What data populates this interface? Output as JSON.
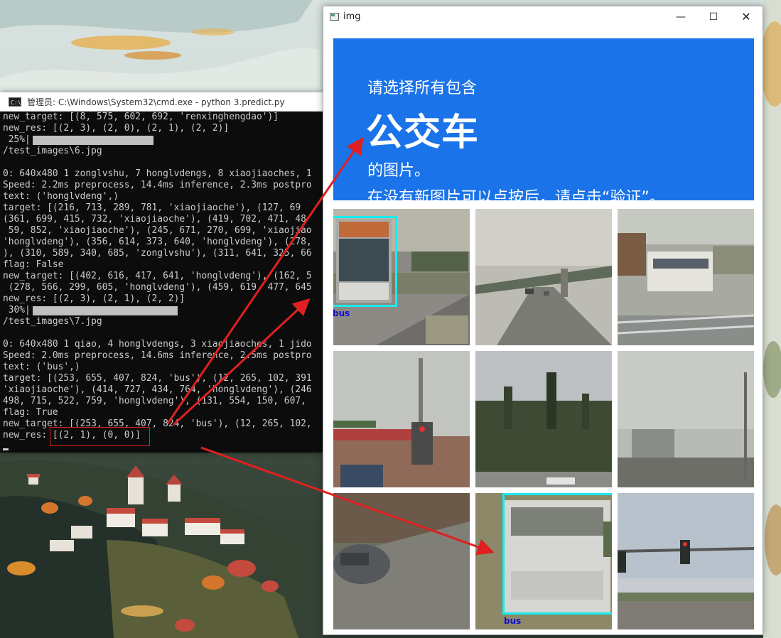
{
  "cmd_window": {
    "title": "管理员: C:\\Windows\\System32\\cmd.exe - python  3.predict.py",
    "lines": [
      "new_target: [(8, 575, 602, 692, 'renxinghengdao')]",
      "new_res: [(2, 3), (2, 0), (2, 1), (2, 2)]",
      " 25%|",
      "/test_images\\6.jpg",
      "",
      "0: 640x480 1 zonglvshu, 7 honglvdengs, 8 xiaojiaoches, 1",
      "Speed: 2.2ms preprocess, 14.4ms inference, 2.3ms postpro",
      "text: ('honglvdeng',)",
      "target: [(216, 713, 289, 781, 'xiaojiaoche'), (127, 69",
      "(361, 699, 415, 732, 'xiaojiaoche'), (419, 702, 471, 48",
      " 59, 852, 'xiaojiaoche'), (245, 671, 270, 699, 'xiaojiao",
      "'honglvdeng'), (356, 614, 373, 640, 'honglvdeng'), (278,",
      "), (310, 589, 340, 685, 'zonglvshu'), (311, 641, 325, 66",
      "flag: False",
      "new_target: [(402, 616, 417, 641, 'honglvdeng'), (162, 5",
      " (278, 566, 299, 605, 'honglvdeng'), (459, 619, 477, 645",
      "new_res: [(2, 3), (2, 1), (2, 2)]",
      " 30%|",
      "/test_images\\7.jpg",
      "",
      "0: 640x480 1 qiao, 4 honglvdengs, 3 xiaojiaoches, 1 jido",
      "Speed: 2.0ms preprocess, 14.6ms inference, 2.5ms postpro",
      "text: ('bus',)",
      "target: [(253, 655, 407, 824, 'bus'), (12, 265, 102, 391",
      "'xiaojiaoche'), (414, 727, 434, 764, 'honglvdeng'), (246",
      "498, 715, 522, 759, 'honglvdeng'), (131, 554, 150, 607,",
      "flag: True",
      "new_target: [(253, 655, 407, 824, 'bus'), (12, 265, 102,",
      "new_res: [(2, 1), (0, 0)]"
    ]
  },
  "img_window": {
    "title": "img",
    "min_glyph": "—",
    "max_glyph": "☐",
    "close_glyph": "✕",
    "captcha": {
      "line1": "请选择所有包含",
      "target": "公交车",
      "line3": "的图片。",
      "line4": "在没有新图片可以点按后，请点击“验证”。"
    },
    "detections": [
      {
        "tile": "row1-col1",
        "label": "bus"
      },
      {
        "tile": "row3-col2",
        "label": "bus"
      }
    ]
  },
  "colors": {
    "captcha_blue": "#1a73e8",
    "bbox_cyan": "#18ecf0",
    "bbox_label": "#1010d0",
    "annotation_red": "#e02020"
  }
}
